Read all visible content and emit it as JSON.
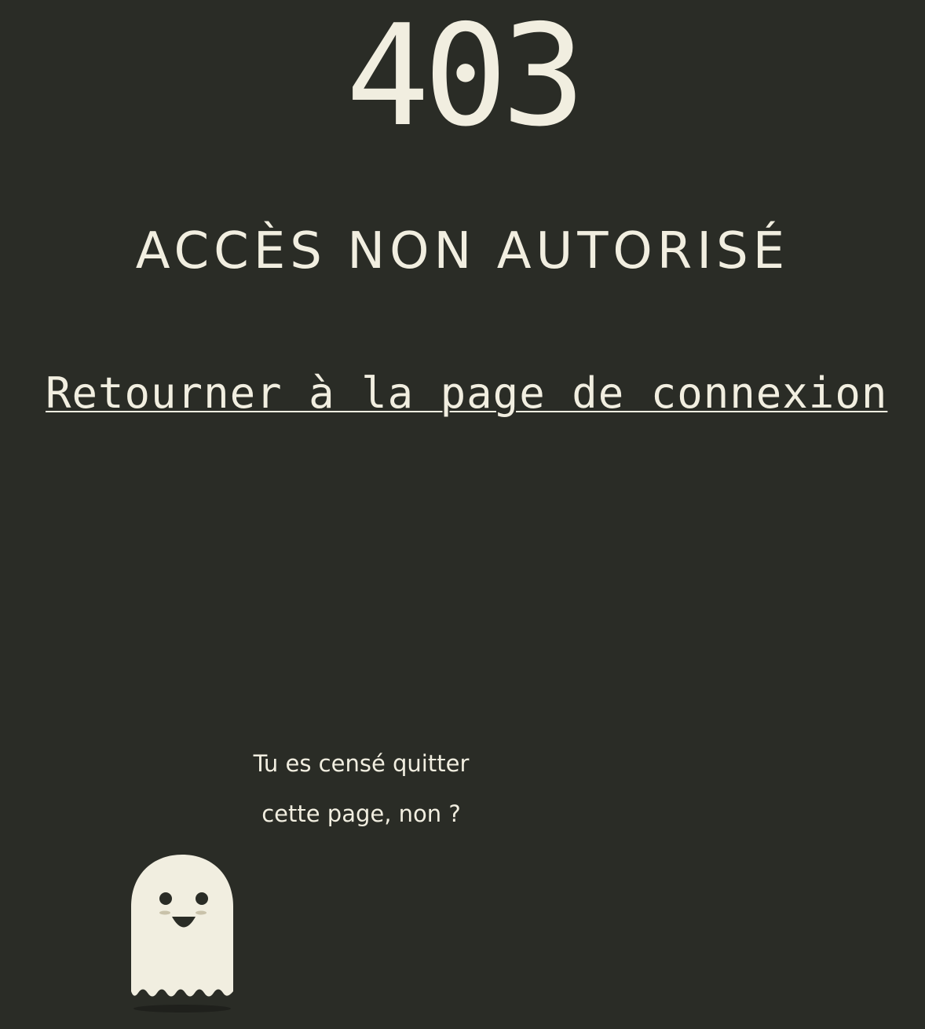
{
  "error": {
    "code": "403",
    "title": "ACCÈS NON AUTORISÉ"
  },
  "link": {
    "label": "Retourner à la page de connexion"
  },
  "message": {
    "line1": "Tu es censé quitter",
    "line2": "cette page, non ?"
  },
  "colors": {
    "background": "#2a2c26",
    "foreground": "#f1eee0"
  }
}
